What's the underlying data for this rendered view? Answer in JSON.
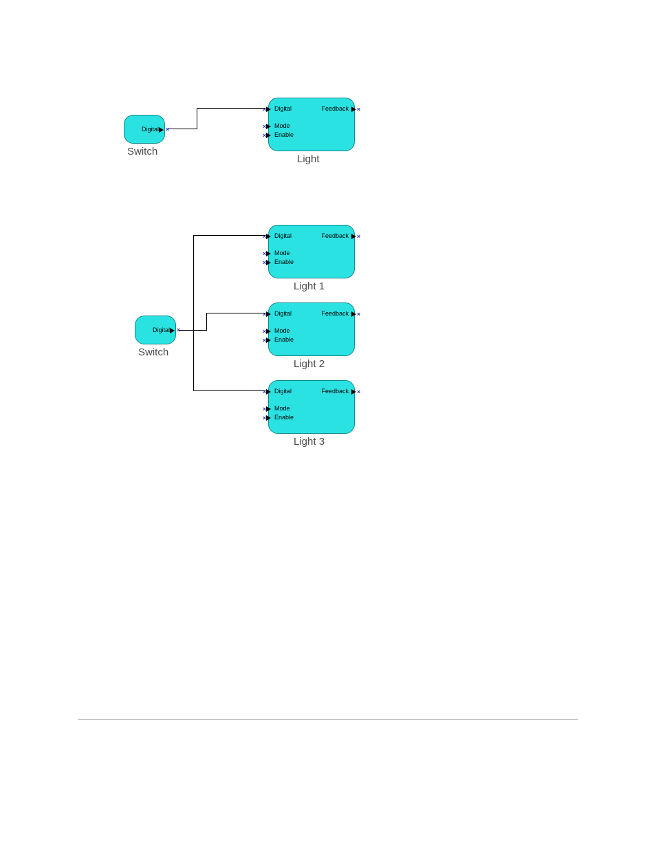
{
  "ports": {
    "digital": "Digital",
    "mode": "Mode",
    "enable": "Enable",
    "feedback": "Feedback"
  },
  "diagram1": {
    "switch": {
      "label": "Switch"
    },
    "light": {
      "label": "Light"
    }
  },
  "diagram2": {
    "switch": {
      "label": "Switch"
    },
    "light1": {
      "label": "Light 1"
    },
    "light2": {
      "label": "Light 2"
    },
    "light3": {
      "label": "Light 3"
    }
  }
}
